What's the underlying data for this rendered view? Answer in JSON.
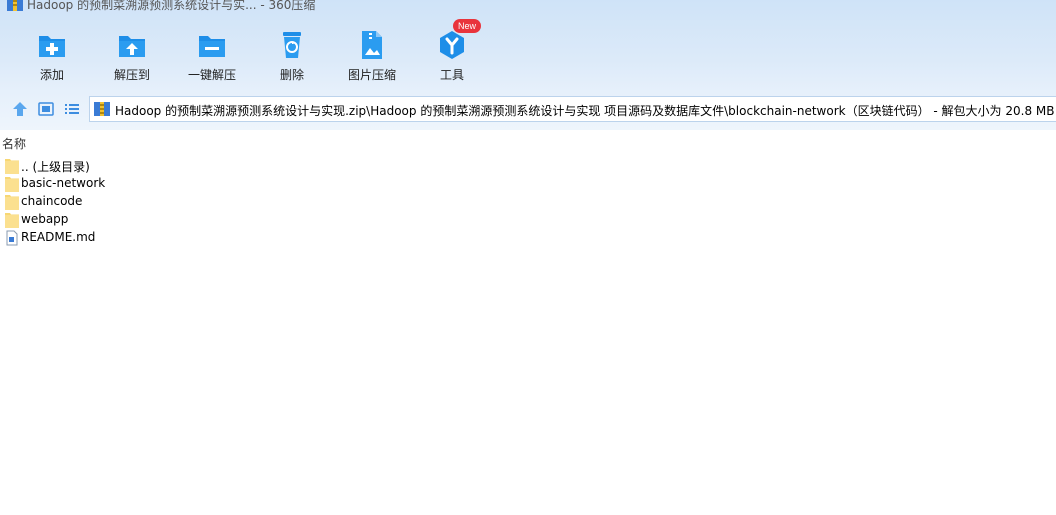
{
  "window": {
    "title": "Hadoop 的预制菜溯源预测系统设计与实... - 360压缩"
  },
  "toolbar": {
    "buttons": [
      {
        "label": "添加",
        "icon": "add-icon"
      },
      {
        "label": "解压到",
        "icon": "extract-to-icon"
      },
      {
        "label": "一键解压",
        "icon": "one-click-extract-icon"
      },
      {
        "label": "删除",
        "icon": "delete-icon"
      },
      {
        "label": "图片压缩",
        "icon": "image-compress-icon"
      },
      {
        "label": "工具",
        "icon": "tools-icon"
      }
    ],
    "new_badge": "New"
  },
  "nav": {
    "address": "Hadoop 的预制菜溯源预测系统设计与实现.zip\\Hadoop 的预制菜溯源预测系统设计与实现 项目源码及数据库文件\\blockchain-network（区块链代码） - 解包大小为 20.8 MB"
  },
  "list": {
    "column_name": "名称",
    "items": [
      {
        "name": ".. (上级目录)",
        "type": "folder"
      },
      {
        "name": "basic-network",
        "type": "folder"
      },
      {
        "name": "chaincode",
        "type": "folder"
      },
      {
        "name": "webapp",
        "type": "folder"
      },
      {
        "name": "README.md",
        "type": "file"
      }
    ]
  },
  "colors": {
    "accent": "#1e8ee8",
    "folder": "#f7d774",
    "badge": "#e9343c"
  }
}
